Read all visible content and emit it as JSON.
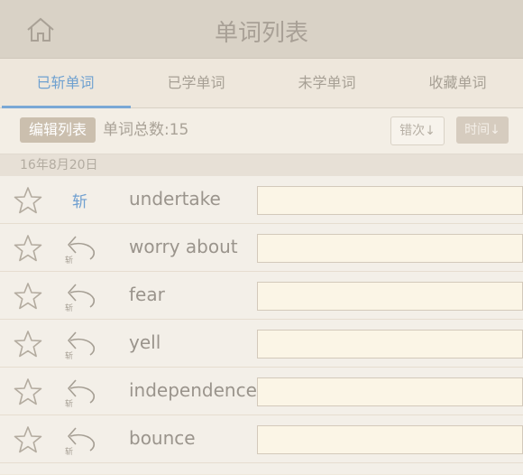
{
  "header": {
    "title": "单词列表",
    "home_icon": "home-icon"
  },
  "tabs": [
    {
      "label": "已斩单词",
      "active": true
    },
    {
      "label": "已学单词",
      "active": false
    },
    {
      "label": "未学单词",
      "active": false
    },
    {
      "label": "收藏单词",
      "active": false
    }
  ],
  "toolbar": {
    "edit_label": "编辑列表",
    "word_count": "单词总数:15",
    "sort_errors": "错次↓",
    "sort_time": "时间↓"
  },
  "date_header": "16年8月20日",
  "words": [
    {
      "word": "undertake",
      "status": "斩",
      "status_type": "text"
    },
    {
      "word": "worry about",
      "status": "斩",
      "status_type": "icon"
    },
    {
      "word": "fear",
      "status": "斩",
      "status_type": "icon"
    },
    {
      "word": "yell",
      "status": "斩",
      "status_type": "icon"
    },
    {
      "word": "independence",
      "status": "斩",
      "status_type": "icon"
    },
    {
      "word": "bounce",
      "status": "斩",
      "status_type": "icon"
    }
  ],
  "colors": {
    "accent": "#6fa1d0",
    "header_bg": "#d9d2c6",
    "input_bg": "#fbf5e6"
  }
}
